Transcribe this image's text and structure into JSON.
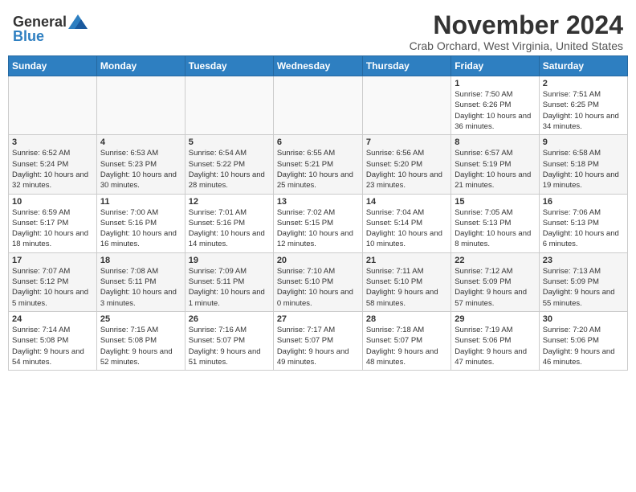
{
  "header": {
    "logo_general": "General",
    "logo_blue": "Blue",
    "month_title": "November 2024",
    "location": "Crab Orchard, West Virginia, United States"
  },
  "days_of_week": [
    "Sunday",
    "Monday",
    "Tuesday",
    "Wednesday",
    "Thursday",
    "Friday",
    "Saturday"
  ],
  "weeks": [
    [
      {
        "day": "",
        "info": ""
      },
      {
        "day": "",
        "info": ""
      },
      {
        "day": "",
        "info": ""
      },
      {
        "day": "",
        "info": ""
      },
      {
        "day": "",
        "info": ""
      },
      {
        "day": "1",
        "info": "Sunrise: 7:50 AM\nSunset: 6:26 PM\nDaylight: 10 hours and 36 minutes."
      },
      {
        "day": "2",
        "info": "Sunrise: 7:51 AM\nSunset: 6:25 PM\nDaylight: 10 hours and 34 minutes."
      }
    ],
    [
      {
        "day": "3",
        "info": "Sunrise: 6:52 AM\nSunset: 5:24 PM\nDaylight: 10 hours and 32 minutes."
      },
      {
        "day": "4",
        "info": "Sunrise: 6:53 AM\nSunset: 5:23 PM\nDaylight: 10 hours and 30 minutes."
      },
      {
        "day": "5",
        "info": "Sunrise: 6:54 AM\nSunset: 5:22 PM\nDaylight: 10 hours and 28 minutes."
      },
      {
        "day": "6",
        "info": "Sunrise: 6:55 AM\nSunset: 5:21 PM\nDaylight: 10 hours and 25 minutes."
      },
      {
        "day": "7",
        "info": "Sunrise: 6:56 AM\nSunset: 5:20 PM\nDaylight: 10 hours and 23 minutes."
      },
      {
        "day": "8",
        "info": "Sunrise: 6:57 AM\nSunset: 5:19 PM\nDaylight: 10 hours and 21 minutes."
      },
      {
        "day": "9",
        "info": "Sunrise: 6:58 AM\nSunset: 5:18 PM\nDaylight: 10 hours and 19 minutes."
      }
    ],
    [
      {
        "day": "10",
        "info": "Sunrise: 6:59 AM\nSunset: 5:17 PM\nDaylight: 10 hours and 18 minutes."
      },
      {
        "day": "11",
        "info": "Sunrise: 7:00 AM\nSunset: 5:16 PM\nDaylight: 10 hours and 16 minutes."
      },
      {
        "day": "12",
        "info": "Sunrise: 7:01 AM\nSunset: 5:16 PM\nDaylight: 10 hours and 14 minutes."
      },
      {
        "day": "13",
        "info": "Sunrise: 7:02 AM\nSunset: 5:15 PM\nDaylight: 10 hours and 12 minutes."
      },
      {
        "day": "14",
        "info": "Sunrise: 7:04 AM\nSunset: 5:14 PM\nDaylight: 10 hours and 10 minutes."
      },
      {
        "day": "15",
        "info": "Sunrise: 7:05 AM\nSunset: 5:13 PM\nDaylight: 10 hours and 8 minutes."
      },
      {
        "day": "16",
        "info": "Sunrise: 7:06 AM\nSunset: 5:13 PM\nDaylight: 10 hours and 6 minutes."
      }
    ],
    [
      {
        "day": "17",
        "info": "Sunrise: 7:07 AM\nSunset: 5:12 PM\nDaylight: 10 hours and 5 minutes."
      },
      {
        "day": "18",
        "info": "Sunrise: 7:08 AM\nSunset: 5:11 PM\nDaylight: 10 hours and 3 minutes."
      },
      {
        "day": "19",
        "info": "Sunrise: 7:09 AM\nSunset: 5:11 PM\nDaylight: 10 hours and 1 minute."
      },
      {
        "day": "20",
        "info": "Sunrise: 7:10 AM\nSunset: 5:10 PM\nDaylight: 10 hours and 0 minutes."
      },
      {
        "day": "21",
        "info": "Sunrise: 7:11 AM\nSunset: 5:10 PM\nDaylight: 9 hours and 58 minutes."
      },
      {
        "day": "22",
        "info": "Sunrise: 7:12 AM\nSunset: 5:09 PM\nDaylight: 9 hours and 57 minutes."
      },
      {
        "day": "23",
        "info": "Sunrise: 7:13 AM\nSunset: 5:09 PM\nDaylight: 9 hours and 55 minutes."
      }
    ],
    [
      {
        "day": "24",
        "info": "Sunrise: 7:14 AM\nSunset: 5:08 PM\nDaylight: 9 hours and 54 minutes."
      },
      {
        "day": "25",
        "info": "Sunrise: 7:15 AM\nSunset: 5:08 PM\nDaylight: 9 hours and 52 minutes."
      },
      {
        "day": "26",
        "info": "Sunrise: 7:16 AM\nSunset: 5:07 PM\nDaylight: 9 hours and 51 minutes."
      },
      {
        "day": "27",
        "info": "Sunrise: 7:17 AM\nSunset: 5:07 PM\nDaylight: 9 hours and 49 minutes."
      },
      {
        "day": "28",
        "info": "Sunrise: 7:18 AM\nSunset: 5:07 PM\nDaylight: 9 hours and 48 minutes."
      },
      {
        "day": "29",
        "info": "Sunrise: 7:19 AM\nSunset: 5:06 PM\nDaylight: 9 hours and 47 minutes."
      },
      {
        "day": "30",
        "info": "Sunrise: 7:20 AM\nSunset: 5:06 PM\nDaylight: 9 hours and 46 minutes."
      }
    ]
  ]
}
